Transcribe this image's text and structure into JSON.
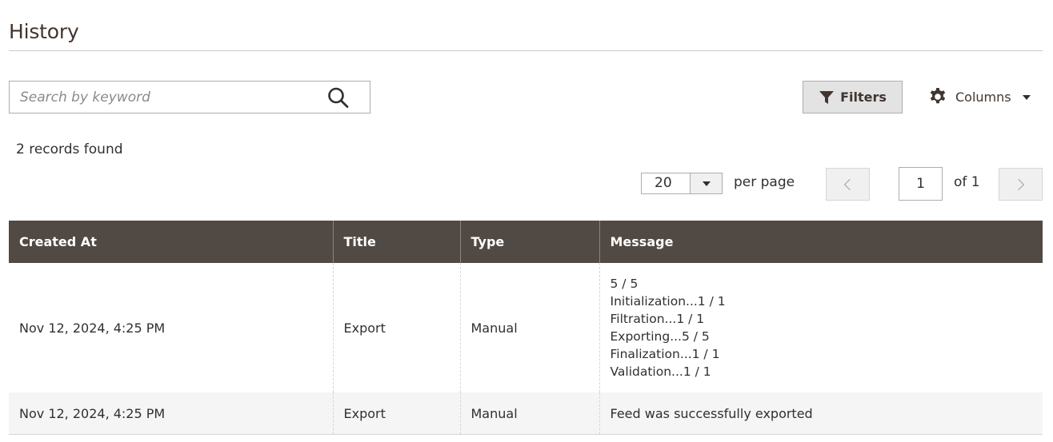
{
  "page": {
    "title": "History"
  },
  "toolbar": {
    "search_placeholder": "Search by keyword",
    "search_value": "",
    "filters_label": "Filters",
    "columns_label": "Columns"
  },
  "records": {
    "found_text": "2 records found"
  },
  "pager": {
    "per_page_value": "20",
    "per_page_label": "per page",
    "current_page": "1",
    "total_text": "of 1"
  },
  "grid": {
    "columns": [
      "Created At",
      "Title",
      "Type",
      "Message"
    ],
    "rows": [
      {
        "created_at": "Nov 12, 2024, 4:25 PM",
        "title": "Export",
        "type": "Manual",
        "message": [
          "5 / 5",
          "Initialization...1 / 1",
          "Filtration...1 / 1",
          "Exporting...5 / 5",
          "Finalization...1 / 1",
          "Validation...1 / 1"
        ]
      },
      {
        "created_at": "Nov 12, 2024, 4:25 PM",
        "title": "Export",
        "type": "Manual",
        "message": [
          "Feed was successfully exported"
        ]
      }
    ]
  },
  "colors": {
    "header_bg": "#514943",
    "title_text": "#41362f",
    "filters_bg": "#e3e3e3",
    "stripe_bg": "#f5f5f5"
  },
  "icons": {
    "search": "search-icon",
    "filter": "filter-icon",
    "columns": "gear-icon",
    "dropdown": "caret-down-icon",
    "prev": "chevron-left-icon",
    "next": "chevron-right-icon"
  }
}
